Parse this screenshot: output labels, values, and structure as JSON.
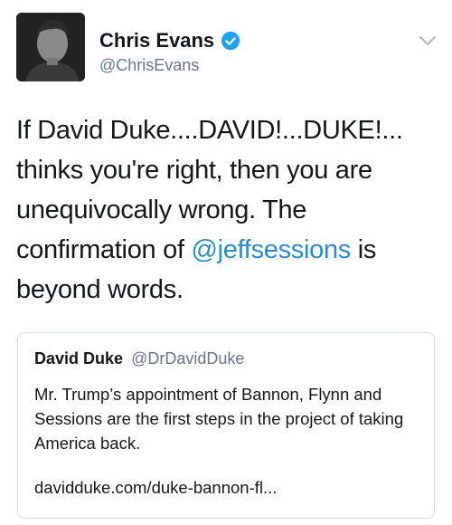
{
  "author": {
    "display_name": "Chris Evans",
    "handle": "@ChrisEvans",
    "verified": true,
    "verified_color": "#1da1f2"
  },
  "tweet": {
    "text_before": "If David Duke....DAVID!...DUKE!... thinks you're right, then you are unequivocally wrong. The confirmation of ",
    "mention": "@jeffsessions",
    "text_after": " is beyond words.",
    "mention_color": "#2b8ccc"
  },
  "quoted_tweet": {
    "display_name": "David Duke",
    "handle": "@DrDavidDuke",
    "text": "Mr. Trump’s appointment of Bannon, Flynn and Sessions are the first steps in the project of taking America back.",
    "link": "davidduke.com/duke-bannon-fl..."
  },
  "icons": {
    "verified": "verified-badge-icon",
    "menu": "chevron-down-icon"
  }
}
